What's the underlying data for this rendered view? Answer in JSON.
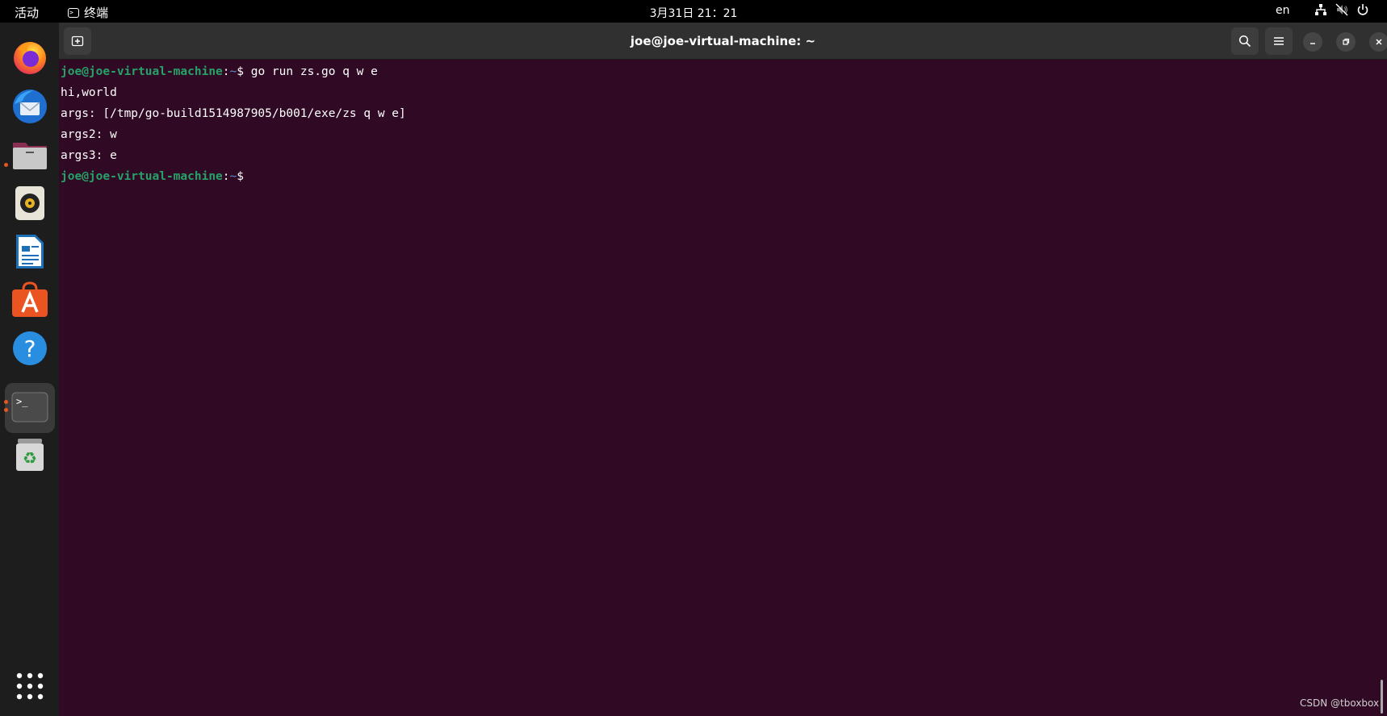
{
  "topbar": {
    "activities": "活动",
    "app_name": "终端",
    "clock": "3月31日 21：21",
    "lang": "en"
  },
  "dock": {
    "items": [
      "firefox",
      "thunderbird",
      "files",
      "rhythmbox",
      "libreoffice-writer",
      "app-center",
      "help",
      "terminal",
      "trash",
      "show-apps"
    ]
  },
  "window": {
    "title": "joe@joe-virtual-machine: ~"
  },
  "terminal": {
    "prompt_user": "joe@joe-virtual-machine",
    "prompt_path": "~",
    "lines": [
      {
        "command": "go run zs.go q w e"
      },
      {
        "output": "hi,world"
      },
      {
        "output": "args: [/tmp/go-build1514987905/b001/exe/zs q w e]"
      },
      {
        "output": "args2: w"
      },
      {
        "output": "args3: e"
      },
      {
        "command": ""
      }
    ]
  },
  "watermark": "CSDN @tboxbox",
  "colors": {
    "terminal_bg": "#300a24",
    "prompt_green": "#26a269",
    "prompt_blue": "#5e8cd6",
    "accent": "#e95420"
  }
}
